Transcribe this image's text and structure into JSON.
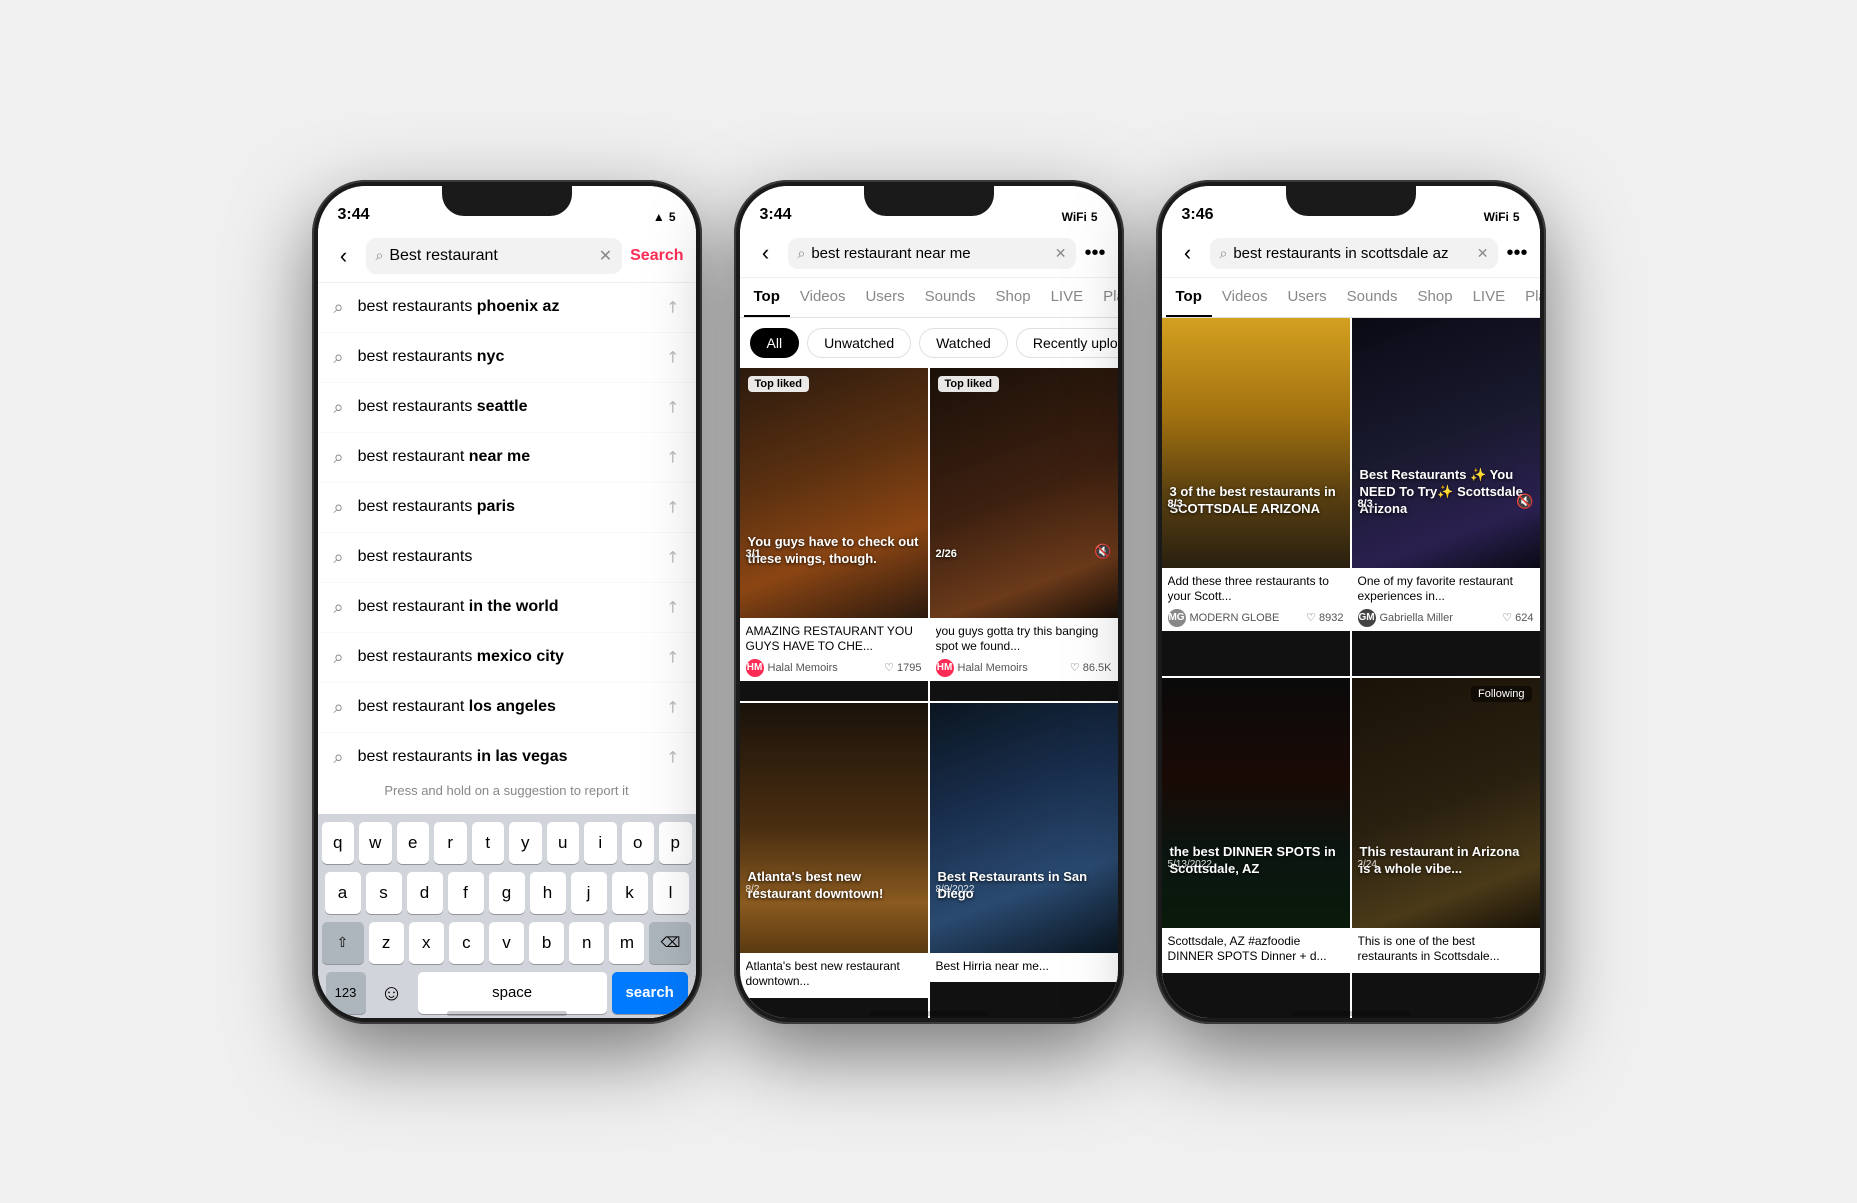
{
  "phone1": {
    "status": {
      "time": "3:44",
      "signal": "▂▄▆",
      "wifi": "WiFi",
      "battery": "5G"
    },
    "search": {
      "placeholder": "Best restaurant",
      "search_label": "Search",
      "hint": "Press and hold on a suggestion to report it"
    },
    "suggestions": [
      {
        "text_plain": "best restaurants ",
        "text_bold": "phoenix az"
      },
      {
        "text_plain": "best restaurants ",
        "text_bold": "nyc"
      },
      {
        "text_plain": "best restaurants ",
        "text_bold": "seattle"
      },
      {
        "text_plain": "best restaurant ",
        "text_bold": "near me"
      },
      {
        "text_plain": "best restaurants ",
        "text_bold": "paris"
      },
      {
        "text_plain": "best restaurants",
        "text_bold": ""
      },
      {
        "text_plain": "best restaurant ",
        "text_bold": "in the world"
      },
      {
        "text_plain": "best restaurants ",
        "text_bold": "mexico city"
      },
      {
        "text_plain": "best restaurant ",
        "text_bold": "los angeles"
      },
      {
        "text_plain": "best restaurants ",
        "text_bold": "in las vegas"
      }
    ],
    "keyboard": {
      "rows": [
        [
          "q",
          "w",
          "e",
          "r",
          "t",
          "y",
          "u",
          "i",
          "o",
          "p"
        ],
        [
          "a",
          "s",
          "d",
          "f",
          "g",
          "h",
          "j",
          "k",
          "l"
        ],
        [
          "⇧",
          "z",
          "x",
          "c",
          "v",
          "b",
          "n",
          "m",
          "⌫"
        ],
        [
          "123",
          "😊",
          "space",
          "search"
        ]
      ],
      "search_label": "search"
    }
  },
  "phone2": {
    "status": {
      "time": "3:44"
    },
    "query": "best restaurant near me",
    "tabs": [
      "Top",
      "Videos",
      "Users",
      "Sounds",
      "Shop",
      "LIVE",
      "Place"
    ],
    "active_tab": "Top",
    "filters": [
      "All",
      "Unwatched",
      "Watched",
      "Recently uploaded"
    ],
    "active_filter": "All",
    "videos": [
      {
        "bg_class": "vbg-1",
        "overlay": "You guys have to check out these wings, though.",
        "badge": "Top liked",
        "count": "3/1",
        "title": "AMAZING RESTAURANT YOU GUYS HAVE TO CHE...",
        "author": "Halal Memoirs",
        "avatar_color": "#fe2c55",
        "avatar_letter": "HM",
        "likes": "1795"
      },
      {
        "bg_class": "vbg-2",
        "overlay": "",
        "badge": "Top liked",
        "count": "2/26",
        "muted": true,
        "title": "you guys gotta try this banging spot we found...",
        "author": "Halal Memoirs",
        "avatar_color": "#fe2c55",
        "avatar_letter": "HM",
        "likes": "86.5K"
      },
      {
        "bg_class": "vbg-3",
        "overlay": "Atlanta's best new restaurant downtown!",
        "date": "8/2",
        "title": "Atlanta's best new restaurant downtown...",
        "author": "",
        "avatar_color": "#888",
        "avatar_letter": "",
        "likes": ""
      },
      {
        "bg_class": "vbg-4",
        "overlay": "Best Restaurants in San Diego",
        "date": "8/9/2022",
        "title": "Best Hirria near me...",
        "author": "",
        "avatar_color": "#888",
        "avatar_letter": "",
        "likes": ""
      }
    ]
  },
  "phone3": {
    "status": {
      "time": "3:46"
    },
    "query": "best restaurants in scottsdale az",
    "tabs": [
      "Top",
      "Videos",
      "Users",
      "Sounds",
      "Shop",
      "LIVE",
      "Place"
    ],
    "active_tab": "Top",
    "videos": [
      {
        "bg_class": "vbg-scotts1",
        "overlay": "3 of the best restaurants in SCOTTSDALE ARIZONA",
        "count": "8/3",
        "title": "Add these three restaurants to your Scott...",
        "author": "MODERN GLOBE",
        "avatar_color": "#888",
        "avatar_letter": "MG",
        "likes": "8932"
      },
      {
        "bg_class": "vbg-scotts2",
        "overlay": "Best Restaurants ✨ You NEED To Try✨ Scottsdale, Arizona",
        "count": "8/3",
        "muted": true,
        "title": "One of my favorite restaurant experiences in...",
        "author": "Gabriella Miller",
        "avatar_color": "#444",
        "avatar_letter": "GM",
        "likes": "624"
      },
      {
        "bg_class": "vbg-scotts3",
        "overlay": "the best DINNER SPOTS in Scottsdale, AZ",
        "date": "5/13/2022",
        "title": "Scottsdale, AZ #azfoodie DINNER SPOTS Dinner + d...",
        "author": "",
        "avatar_color": "#555",
        "avatar_letter": "",
        "likes": ""
      },
      {
        "bg_class": "vbg-scotts4",
        "overlay": "This restaurant in Arizona is a whole vibe...",
        "date": "2/24",
        "following": "Following",
        "title": "This is one of the best restaurants in Scottsdale...",
        "author": "",
        "avatar_color": "#555",
        "avatar_letter": "",
        "likes": ""
      }
    ]
  },
  "icons": {
    "back": "‹",
    "search": "🔍",
    "clear": "✕",
    "more": "•••",
    "arrow_up_left": "↗",
    "heart": "♡",
    "speaker": "🔇",
    "globe": "🌐",
    "mic": "🎤"
  }
}
